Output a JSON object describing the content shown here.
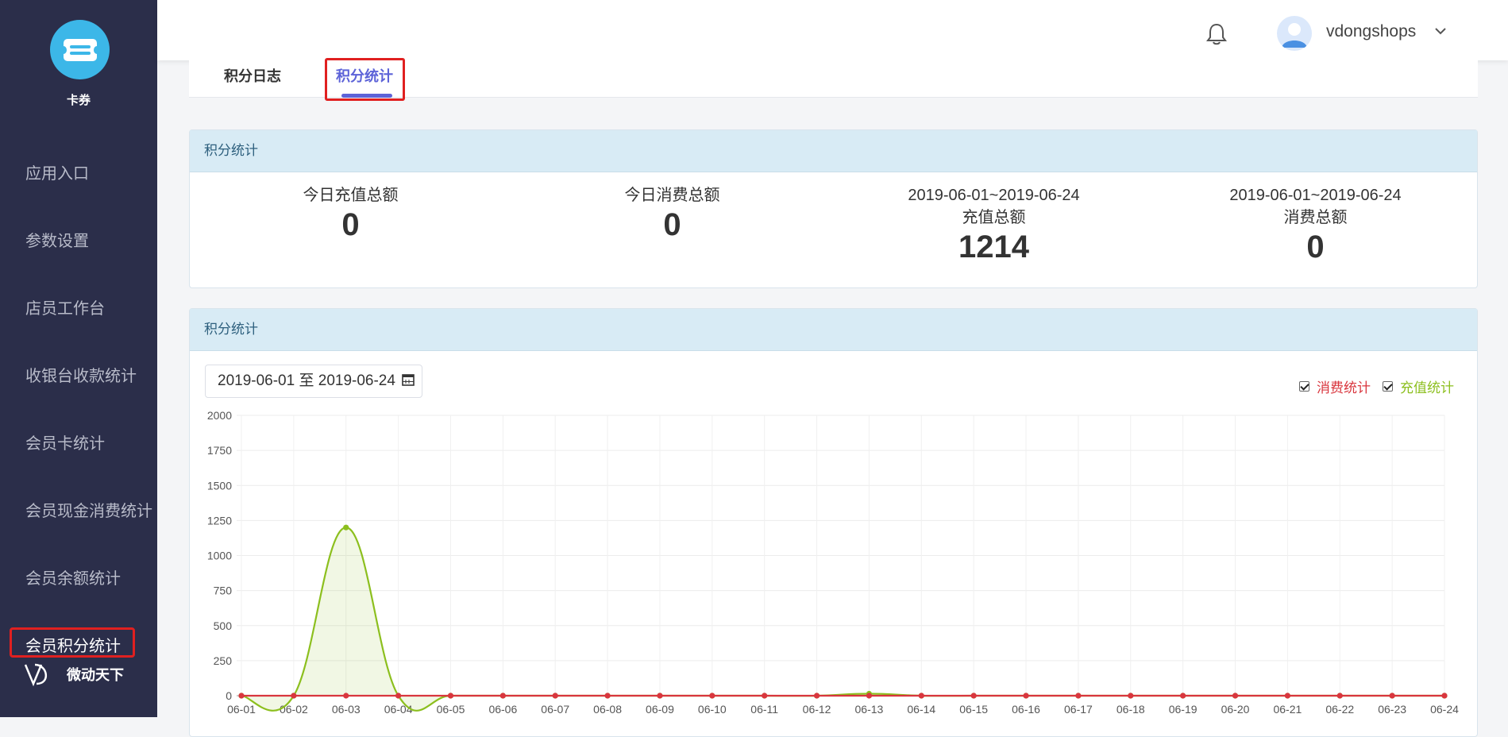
{
  "sidebar": {
    "logo_label": "卡券",
    "items": [
      {
        "label": "应用入口"
      },
      {
        "label": "参数设置"
      },
      {
        "label": "店员工作台"
      },
      {
        "label": "收银台收款统计"
      },
      {
        "label": "会员卡统计"
      },
      {
        "label": "会员现金消费统计"
      },
      {
        "label": "会员余额统计"
      },
      {
        "label": "会员积分统计"
      }
    ],
    "brand": "微动天下"
  },
  "header": {
    "username": "vdongshops"
  },
  "tabs": [
    {
      "label": "积分日志"
    },
    {
      "label": "积分统计"
    }
  ],
  "summary": {
    "title": "积分统计",
    "stats": [
      {
        "label": "今日充值总额",
        "value": "0"
      },
      {
        "label": "今日消费总额",
        "value": "0"
      },
      {
        "range": "2019-06-01~2019-06-24",
        "label": "充值总额",
        "value": "1214"
      },
      {
        "range": "2019-06-01~2019-06-24",
        "label": "消费总额",
        "value": "0"
      }
    ]
  },
  "chart_panel": {
    "title": "积分统计",
    "date_range": "2019-06-01 至 2019-06-24",
    "legend": [
      {
        "label": "消费统计",
        "color": "#d9363e",
        "checked": true
      },
      {
        "label": "充值统计",
        "color": "#8cbf1e",
        "checked": true
      }
    ]
  },
  "chart_data": {
    "type": "line",
    "categories": [
      "06-01",
      "06-02",
      "06-03",
      "06-04",
      "06-05",
      "06-06",
      "06-07",
      "06-08",
      "06-09",
      "06-10",
      "06-11",
      "06-12",
      "06-13",
      "06-14",
      "06-15",
      "06-16",
      "06-17",
      "06-18",
      "06-19",
      "06-20",
      "06-21",
      "06-22",
      "06-23",
      "06-24"
    ],
    "ylim": [
      0,
      2000
    ],
    "yticks": [
      0,
      250,
      500,
      750,
      1000,
      1250,
      1500,
      1750,
      2000
    ],
    "grid": true,
    "legend_position": "top-right",
    "series": [
      {
        "name": "消费统计",
        "color": "#d9363e",
        "values": [
          0,
          0,
          0,
          0,
          0,
          0,
          0,
          0,
          0,
          0,
          0,
          0,
          0,
          0,
          0,
          0,
          0,
          0,
          0,
          0,
          0,
          0,
          0,
          0
        ]
      },
      {
        "name": "充值统计",
        "color": "#8cbf1e",
        "values": [
          0,
          0,
          1200,
          0,
          0,
          0,
          0,
          0,
          0,
          0,
          0,
          0,
          14,
          0,
          0,
          0,
          0,
          0,
          0,
          0,
          0,
          0,
          0,
          0
        ]
      }
    ]
  }
}
